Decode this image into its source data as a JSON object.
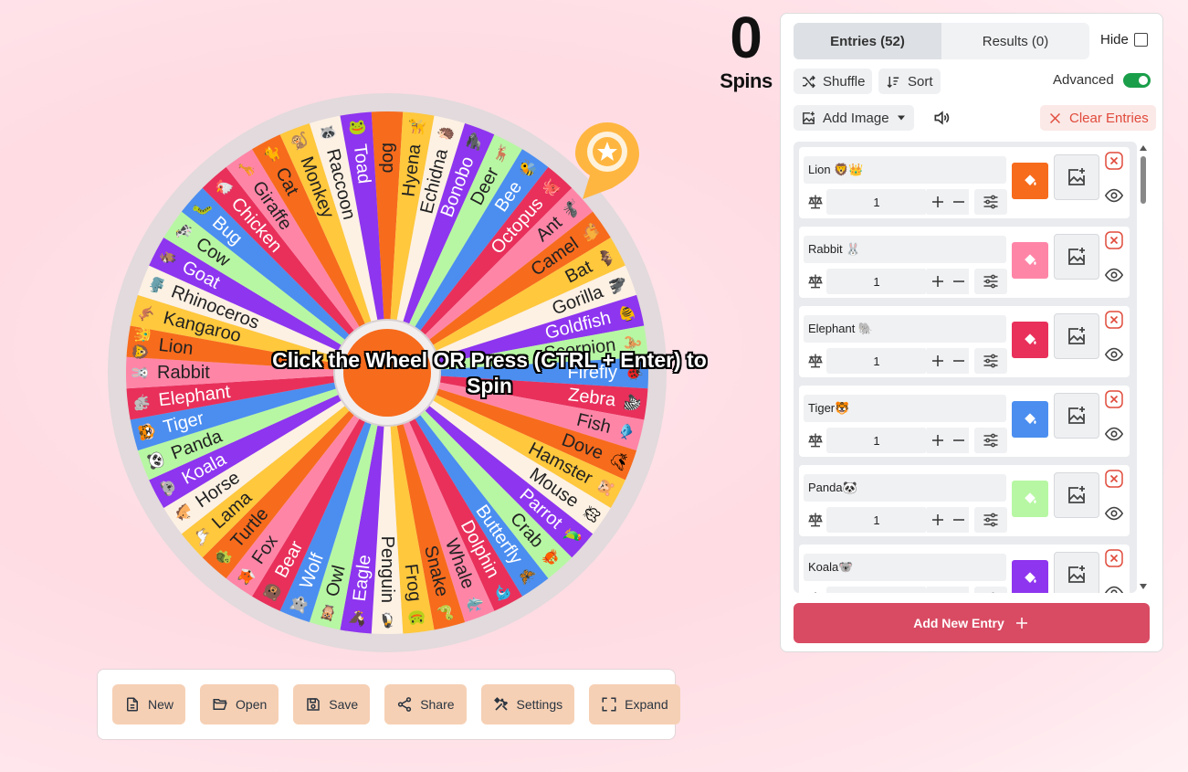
{
  "wheel": {
    "cta": "Click the Wheel OR Press (CTRL + Enter) to Spin",
    "segments": [
      {
        "label": "dog",
        "emoji": "",
        "color": "#f76b1c"
      },
      {
        "label": "Hyena",
        "emoji": "🦮",
        "color": "#ffc83d"
      },
      {
        "label": "Echidna",
        "emoji": "🦔",
        "color": "#fdf1e4"
      },
      {
        "label": "Bonobo",
        "emoji": "🦍",
        "color": "#8e35ef"
      },
      {
        "label": "Deer",
        "emoji": "🦌",
        "color": "#b7f7a3"
      },
      {
        "label": "Bee",
        "emoji": "🐝",
        "color": "#4b8ef0"
      },
      {
        "label": "Octopus",
        "emoji": "🐙",
        "color": "#e8305b"
      },
      {
        "label": "Ant",
        "emoji": "🐜",
        "color": "#ff85a7"
      },
      {
        "label": "Camel",
        "emoji": "🐫",
        "color": "#f76b1c"
      },
      {
        "label": "Bat",
        "emoji": "🦇",
        "color": "#ffc83d"
      },
      {
        "label": "Gorilla",
        "emoji": "🦍",
        "color": "#fdf1e4"
      },
      {
        "label": "Goldfish",
        "emoji": "🐠",
        "color": "#8e35ef"
      },
      {
        "label": "Scorpion",
        "emoji": "🦂",
        "color": "#b7f7a3"
      },
      {
        "label": "Firefly",
        "emoji": "🐞",
        "color": "#4b8ef0"
      },
      {
        "label": "Zebra",
        "emoji": "🦓",
        "color": "#e8305b"
      },
      {
        "label": "Fish",
        "emoji": "🐟",
        "color": "#ff85a7"
      },
      {
        "label": "Dove",
        "emoji": "🕊",
        "color": "#f76b1c"
      },
      {
        "label": "Hamster",
        "emoji": "🐹",
        "color": "#ffc83d"
      },
      {
        "label": "Mouse",
        "emoji": "🐭",
        "color": "#fdf1e4"
      },
      {
        "label": "Parrot",
        "emoji": "🦜",
        "color": "#8e35ef"
      },
      {
        "label": "Crab",
        "emoji": "🦀",
        "color": "#b7f7a3"
      },
      {
        "label": "Butterfly",
        "emoji": "🦋",
        "color": "#4b8ef0"
      },
      {
        "label": "Dolphin",
        "emoji": "🐬",
        "color": "#e8305b"
      },
      {
        "label": "Whale",
        "emoji": "🐳",
        "color": "#ff85a7"
      },
      {
        "label": "Snake",
        "emoji": "🐍",
        "color": "#f76b1c"
      },
      {
        "label": "Frog",
        "emoji": "🐸",
        "color": "#ffc83d"
      },
      {
        "label": "Penguin",
        "emoji": "🐧",
        "color": "#fdf1e4"
      },
      {
        "label": "Eagle",
        "emoji": "🦅",
        "color": "#8e35ef"
      },
      {
        "label": "Owl",
        "emoji": "🦉",
        "color": "#b7f7a3"
      },
      {
        "label": "Wolf",
        "emoji": "🐺",
        "color": "#4b8ef0"
      },
      {
        "label": "Bear",
        "emoji": "🐻",
        "color": "#e8305b"
      },
      {
        "label": "Fox",
        "emoji": "🦊",
        "color": "#ff85a7"
      },
      {
        "label": "Turtle",
        "emoji": "🐢",
        "color": "#f76b1c"
      },
      {
        "label": "Lama",
        "emoji": "🦙",
        "color": "#ffc83d"
      },
      {
        "label": "Horse",
        "emoji": "🐴",
        "color": "#fdf1e4"
      },
      {
        "label": "Koala",
        "emoji": "🐨",
        "color": "#8e35ef"
      },
      {
        "label": "Panda",
        "emoji": "🐼",
        "color": "#b7f7a3"
      },
      {
        "label": "Tiger",
        "emoji": "🐯",
        "color": "#4b8ef0"
      },
      {
        "label": "Elephant",
        "emoji": "🐘",
        "color": "#e8305b"
      },
      {
        "label": "Rabbit",
        "emoji": "🐰",
        "color": "#ff85a7"
      },
      {
        "label": "Lion",
        "emoji": "🦁👑",
        "color": "#f76b1c"
      },
      {
        "label": "Kangaroo",
        "emoji": "🦘",
        "color": "#ffc83d"
      },
      {
        "label": "Rhinoceros",
        "emoji": "🦏",
        "color": "#fdf1e4"
      },
      {
        "label": "Goat",
        "emoji": "🐐",
        "color": "#8e35ef"
      },
      {
        "label": "Cow",
        "emoji": "🐄",
        "color": "#b7f7a3"
      },
      {
        "label": "Bug",
        "emoji": "🐛",
        "color": "#4b8ef0"
      },
      {
        "label": "Chicken",
        "emoji": "🐔",
        "color": "#e8305b"
      },
      {
        "label": "Giraffe",
        "emoji": "🦒",
        "color": "#ff85a7"
      },
      {
        "label": "Cat",
        "emoji": "🐈",
        "color": "#f76b1c"
      },
      {
        "label": "Monkey",
        "emoji": "🐒",
        "color": "#ffc83d"
      },
      {
        "label": "Raccoon",
        "emoji": "🦝",
        "color": "#fdf1e4"
      },
      {
        "label": "Toad",
        "emoji": "🐸",
        "color": "#8e35ef"
      }
    ]
  },
  "spins": {
    "count": "0",
    "label": "Spins"
  },
  "toolbar": {
    "new": "New",
    "open": "Open",
    "save": "Save",
    "share": "Share",
    "settings": "Settings",
    "expand": "Expand"
  },
  "panel": {
    "tab_entries": "Entries (52)",
    "tab_results": "Results (0)",
    "hide": "Hide",
    "shuffle": "Shuffle",
    "sort": "Sort",
    "advanced": "Advanced",
    "add_image": "Add Image",
    "clear_entries": "Clear Entries",
    "add_new_entry": "Add New Entry",
    "entries": [
      {
        "name": "Lion 🦁👑",
        "weight": "1",
        "color": "#f76b1c"
      },
      {
        "name": "Rabbit 🐰",
        "weight": "1",
        "color": "#ff85a7"
      },
      {
        "name": "Elephant 🐘",
        "weight": "1",
        "color": "#e8305b"
      },
      {
        "name": "Tiger🐯",
        "weight": "1",
        "color": "#4b8ef0"
      },
      {
        "name": "Panda🐼",
        "weight": "1",
        "color": "#b7f7a3"
      },
      {
        "name": "Koala🐨",
        "weight": "1",
        "color": "#8e35ef"
      }
    ]
  }
}
